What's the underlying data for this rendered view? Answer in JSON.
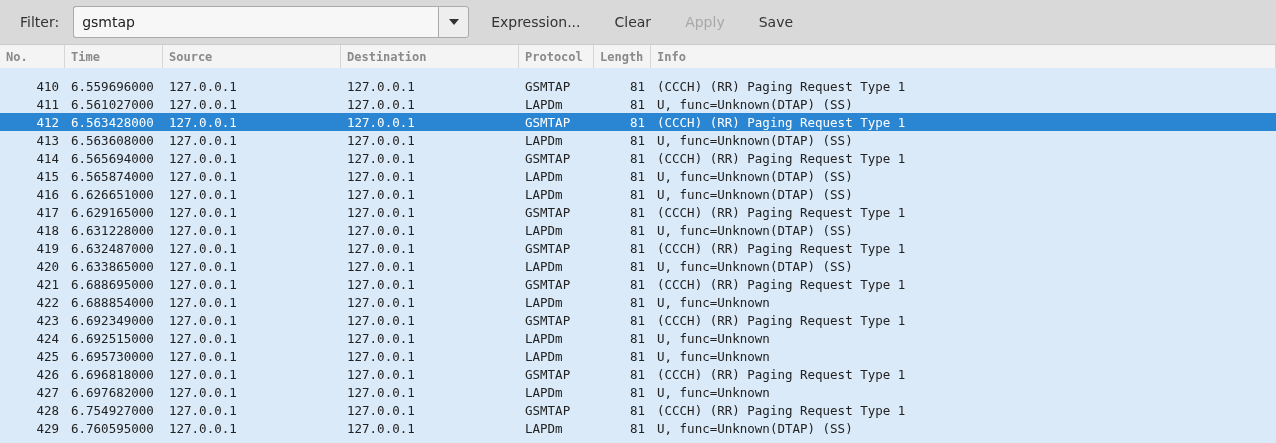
{
  "toolbar": {
    "filter_label": "Filter:",
    "filter_value": "gsmtap",
    "buttons": [
      {
        "label": "Expression...",
        "disabled": false
      },
      {
        "label": "Clear",
        "disabled": false
      },
      {
        "label": "Apply",
        "disabled": true
      },
      {
        "label": "Save",
        "disabled": false
      }
    ]
  },
  "table": {
    "columns": [
      "No.",
      "Time",
      "Source",
      "Destination",
      "Protocol",
      "Length",
      "Info"
    ],
    "rows": [
      {
        "cells": [
          "410",
          "6.559696000",
          "127.0.0.1",
          "127.0.0.1",
          "GSMTAP",
          "81",
          "(CCCH) (RR) Paging Request Type 1"
        ],
        "selected": false
      },
      {
        "cells": [
          "411",
          "6.561027000",
          "127.0.0.1",
          "127.0.0.1",
          "LAPDm",
          "81",
          "U, func=Unknown(DTAP) (SS)"
        ],
        "selected": false
      },
      {
        "cells": [
          "412",
          "6.563428000",
          "127.0.0.1",
          "127.0.0.1",
          "GSMTAP",
          "81",
          "(CCCH) (RR) Paging Request Type 1"
        ],
        "selected": true
      },
      {
        "cells": [
          "413",
          "6.563608000",
          "127.0.0.1",
          "127.0.0.1",
          "LAPDm",
          "81",
          "U, func=Unknown(DTAP) (SS)"
        ],
        "selected": false
      },
      {
        "cells": [
          "414",
          "6.565694000",
          "127.0.0.1",
          "127.0.0.1",
          "GSMTAP",
          "81",
          "(CCCH) (RR) Paging Request Type 1"
        ],
        "selected": false
      },
      {
        "cells": [
          "415",
          "6.565874000",
          "127.0.0.1",
          "127.0.0.1",
          "LAPDm",
          "81",
          "U, func=Unknown(DTAP) (SS)"
        ],
        "selected": false
      },
      {
        "cells": [
          "416",
          "6.626651000",
          "127.0.0.1",
          "127.0.0.1",
          "LAPDm",
          "81",
          "U, func=Unknown(DTAP) (SS)"
        ],
        "selected": false
      },
      {
        "cells": [
          "417",
          "6.629165000",
          "127.0.0.1",
          "127.0.0.1",
          "GSMTAP",
          "81",
          "(CCCH) (RR) Paging Request Type 1"
        ],
        "selected": false
      },
      {
        "cells": [
          "418",
          "6.631228000",
          "127.0.0.1",
          "127.0.0.1",
          "LAPDm",
          "81",
          "U, func=Unknown(DTAP) (SS)"
        ],
        "selected": false
      },
      {
        "cells": [
          "419",
          "6.632487000",
          "127.0.0.1",
          "127.0.0.1",
          "GSMTAP",
          "81",
          "(CCCH) (RR) Paging Request Type 1"
        ],
        "selected": false
      },
      {
        "cells": [
          "420",
          "6.633865000",
          "127.0.0.1",
          "127.0.0.1",
          "LAPDm",
          "81",
          "U, func=Unknown(DTAP) (SS)"
        ],
        "selected": false
      },
      {
        "cells": [
          "421",
          "6.688695000",
          "127.0.0.1",
          "127.0.0.1",
          "GSMTAP",
          "81",
          "(CCCH) (RR) Paging Request Type 1"
        ],
        "selected": false
      },
      {
        "cells": [
          "422",
          "6.688854000",
          "127.0.0.1",
          "127.0.0.1",
          "LAPDm",
          "81",
          "U, func=Unknown"
        ],
        "selected": false
      },
      {
        "cells": [
          "423",
          "6.692349000",
          "127.0.0.1",
          "127.0.0.1",
          "GSMTAP",
          "81",
          "(CCCH) (RR) Paging Request Type 1"
        ],
        "selected": false
      },
      {
        "cells": [
          "424",
          "6.692515000",
          "127.0.0.1",
          "127.0.0.1",
          "LAPDm",
          "81",
          "U, func=Unknown"
        ],
        "selected": false
      },
      {
        "cells": [
          "425",
          "6.695730000",
          "127.0.0.1",
          "127.0.0.1",
          "LAPDm",
          "81",
          "U, func=Unknown"
        ],
        "selected": false
      },
      {
        "cells": [
          "426",
          "6.696818000",
          "127.0.0.1",
          "127.0.0.1",
          "GSMTAP",
          "81",
          "(CCCH) (RR) Paging Request Type 1"
        ],
        "selected": false
      },
      {
        "cells": [
          "427",
          "6.697682000",
          "127.0.0.1",
          "127.0.0.1",
          "LAPDm",
          "81",
          "U, func=Unknown"
        ],
        "selected": false
      },
      {
        "cells": [
          "428",
          "6.754927000",
          "127.0.0.1",
          "127.0.0.1",
          "GSMTAP",
          "81",
          "(CCCH) (RR) Paging Request Type 1"
        ],
        "selected": false
      },
      {
        "cells": [
          "429",
          "6.760595000",
          "127.0.0.1",
          "127.0.0.1",
          "LAPDm",
          "81",
          "U, func=Unknown(DTAP) (SS)"
        ],
        "selected": false
      }
    ]
  }
}
